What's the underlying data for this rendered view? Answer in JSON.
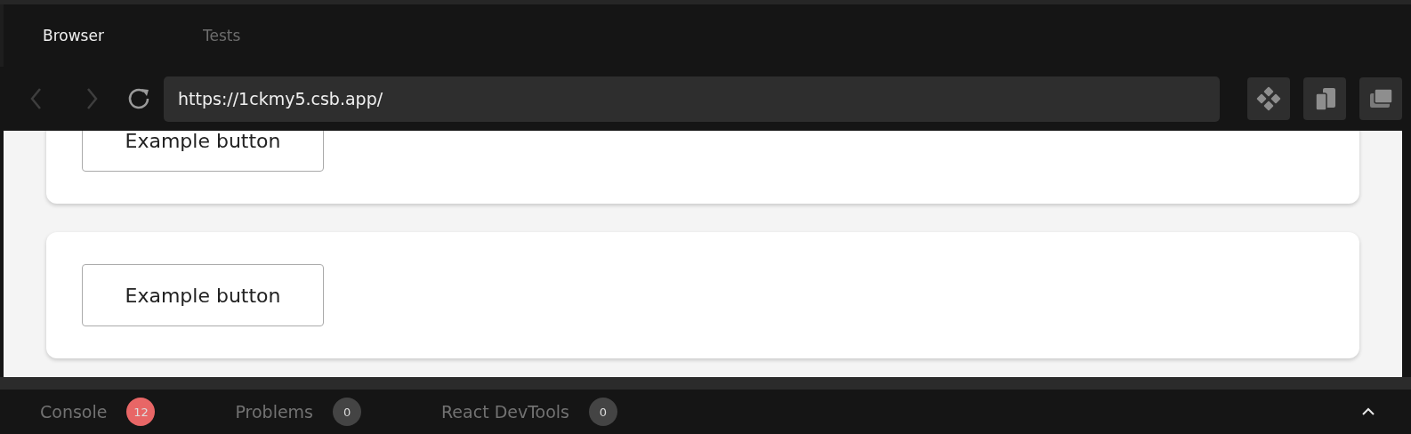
{
  "tabs": [
    {
      "label": "Browser",
      "selected": true
    },
    {
      "label": "Tests",
      "selected": false
    }
  ],
  "toolbar": {
    "url": "https://1ckmy5.csb.app/"
  },
  "preview": {
    "cards": [
      {
        "button": "Example button"
      },
      {
        "button": "Example button"
      }
    ]
  },
  "bottom_tabs": [
    {
      "label": "Console",
      "count": "12",
      "color": "#e86666"
    },
    {
      "label": "Problems",
      "count": "0",
      "color": "#444444"
    },
    {
      "label": "React DevTools",
      "count": "0",
      "color": "#444444"
    }
  ]
}
